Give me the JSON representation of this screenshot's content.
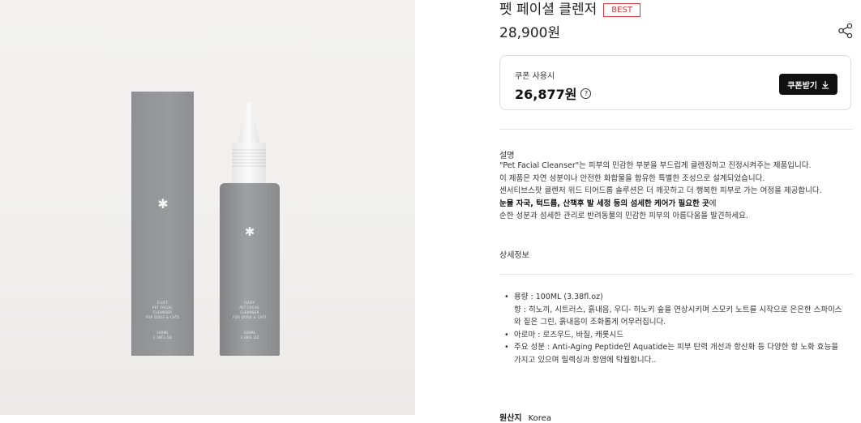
{
  "product": {
    "title": "펫 페이셜 클렌저",
    "badge": "BEST",
    "price": "28,900원"
  },
  "image": {
    "box_lines": [
      "FLUFF",
      "PET FACIAL",
      "CLEANSER",
      "FOR DOGS & CATS"
    ],
    "box_volume": [
      "100ML",
      "3.38FL.OZ"
    ],
    "bottle_lines": [
      "FLUFF",
      "PET FACIAL",
      "CLEANSER",
      "FOR DOGS & CATS"
    ],
    "bottle_volume": [
      "100ML",
      "3.38FL.OZ"
    ]
  },
  "coupon": {
    "label": "쿠폰 사용시",
    "price": "26,877원",
    "help_icon": "?",
    "button_label": "쿠폰받기",
    "button_icon": "download-icon"
  },
  "description": {
    "heading": "설명",
    "lines": [
      "\"Pet Facial Cleanser\"는 피부의 민감한 부분을 부드럽게 클렌징하고 진정시켜주는 제품입니다.",
      "이 제품은 자연 성분이나 안전한 화합물을 함유한 특별한 조성으로 설계되었습니다.",
      "센서티브스팟 클렌저 위드 티어드롭 솔루션은 더 깨끗하고 더 행복한 피부로 가는 여정을 제공합니다."
    ],
    "bold_line": "눈물 자국, 턱드름, 산책후 발 세정 등의 섬세한 케어가 필요한 곳",
    "bold_line_suffix": "에",
    "last_line": "순한 성분과 섬세한 관리로 반려동물의 민감한 피부의 아름다움을 발견하세요."
  },
  "detail_info": {
    "heading": "상세정보",
    "items": [
      {
        "line1": "용량 : 100ML (3.38fl.oz)",
        "line2": "향 : 히노끼, 시트러스, 흙내음, 우디- 히노키 숲을 연상시키며 스모키 노트를 시작으로 은은한 스파이스",
        "line3": "와 짙은 그린, 흙내음이 조화롭게 어우러집니다."
      },
      {
        "line1": "아로마 : 로즈우드, 바질, 캐롯시드"
      },
      {
        "line1": "주요 성분 : Anti-Aging Peptide인 Aquatide는 피부 탄력 개선과 항산화 등 다양한 항 노화 효능을",
        "line2": "가지고 있으며 릴렉싱과 항염에 탁월합니다.."
      }
    ]
  },
  "origin": {
    "label": "원산지",
    "value": "Korea"
  }
}
